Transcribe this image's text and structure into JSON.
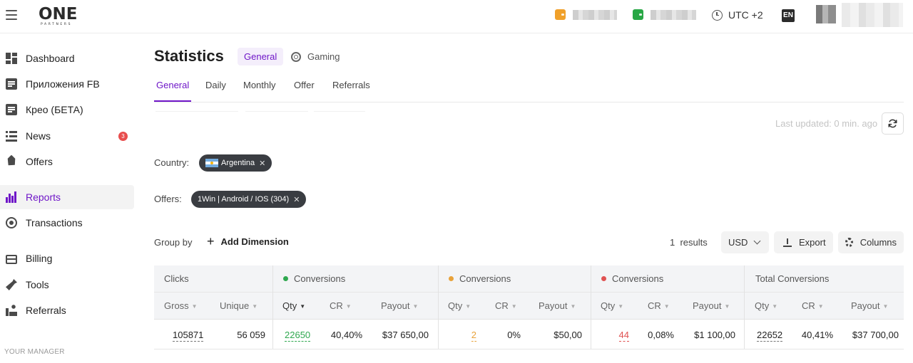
{
  "topbar": {
    "logo_main": "ONE",
    "logo_sub": "PARTNERS",
    "timezone": "UTC +2",
    "language": "EN",
    "wallet_colors": [
      "#f0a02a",
      "#28a745"
    ]
  },
  "sidebar": {
    "items": [
      {
        "label": "Dashboard",
        "icon": "dashboard-icon"
      },
      {
        "label": "Приложения FB",
        "icon": "document-icon"
      },
      {
        "label": "Крео (БЕТА)",
        "icon": "document-icon"
      },
      {
        "label": "News",
        "icon": "news-icon",
        "badge": "3"
      },
      {
        "label": "Offers",
        "icon": "tag-icon"
      },
      {
        "label": "Reports",
        "icon": "bar-chart-icon",
        "active": true
      },
      {
        "label": "Transactions",
        "icon": "radar-icon"
      },
      {
        "label": "Billing",
        "icon": "credit-card-icon"
      },
      {
        "label": "Tools",
        "icon": "wrench-icon"
      },
      {
        "label": "Referrals",
        "icon": "referrals-icon"
      }
    ],
    "section_label": "YOUR MANAGER"
  },
  "main": {
    "title": "Statistics",
    "mode_tabs": [
      "General",
      "Gaming"
    ],
    "tabs": [
      "General",
      "Daily",
      "Monthly",
      "Offer",
      "Referrals"
    ],
    "active_tab": "General",
    "last_updated": "Last updated: 0 min. ago",
    "filters": {
      "country_label": "Country:",
      "country_value": "Argentina",
      "offers_label": "Offers:",
      "offers_value": "1Win | Android / IOS (304)"
    },
    "toolbar": {
      "group_by": "Group by",
      "add_dimension": "Add Dimension",
      "results_count": "1",
      "results_label": "results",
      "currency": "USD",
      "export": "Export",
      "columns": "Columns"
    },
    "table": {
      "groups": [
        "Clicks",
        "Conversions",
        "Conversions",
        "Conversions",
        "Total Conversions"
      ],
      "group_dot_colors": [
        "",
        "#2fa84f",
        "#e8a23a",
        "#e05252",
        ""
      ],
      "subheaders": [
        "Gross",
        "Unique",
        "Qty",
        "CR",
        "Payout",
        "Qty",
        "CR",
        "Payout",
        "Qty",
        "CR",
        "Payout",
        "Qty",
        "CR",
        "Payout"
      ],
      "row": [
        "105871",
        "56 059",
        "22650",
        "40,40%",
        "$37 650,00",
        "2",
        "0%",
        "$50,00",
        "44",
        "0,08%",
        "$1 100,00",
        "22652",
        "40,41%",
        "$37 700,00"
      ]
    }
  }
}
